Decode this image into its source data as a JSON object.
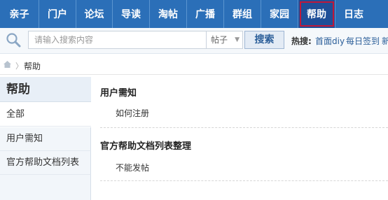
{
  "nav": {
    "items": [
      {
        "label": "亲子"
      },
      {
        "label": "门户"
      },
      {
        "label": "论坛"
      },
      {
        "label": "导读"
      },
      {
        "label": "淘帖"
      },
      {
        "label": "广播"
      },
      {
        "label": "群组"
      },
      {
        "label": "家园"
      },
      {
        "label": "帮助"
      },
      {
        "label": "日志"
      }
    ],
    "active_index": 8
  },
  "search": {
    "placeholder": "请输入搜索内容",
    "scope": "帖子",
    "button": "搜索",
    "hot_label": "热搜:",
    "hot_links": [
      "首面diy",
      "每日签到",
      "新"
    ]
  },
  "breadcrumb": {
    "current": "帮助"
  },
  "sidebar": {
    "title": "帮助",
    "items": [
      {
        "label": "全部"
      },
      {
        "label": "用户需知"
      },
      {
        "label": "官方帮助文档列表"
      }
    ]
  },
  "main": {
    "sections": [
      {
        "title": "用户需知",
        "items": [
          "如何注册"
        ]
      },
      {
        "title": "官方帮助文档列表整理",
        "items": [
          "不能发帖"
        ]
      }
    ]
  },
  "colors": {
    "nav_bg": "#2b6fb8",
    "nav_active_border": "#c0183a",
    "link": "#2b5e99"
  }
}
